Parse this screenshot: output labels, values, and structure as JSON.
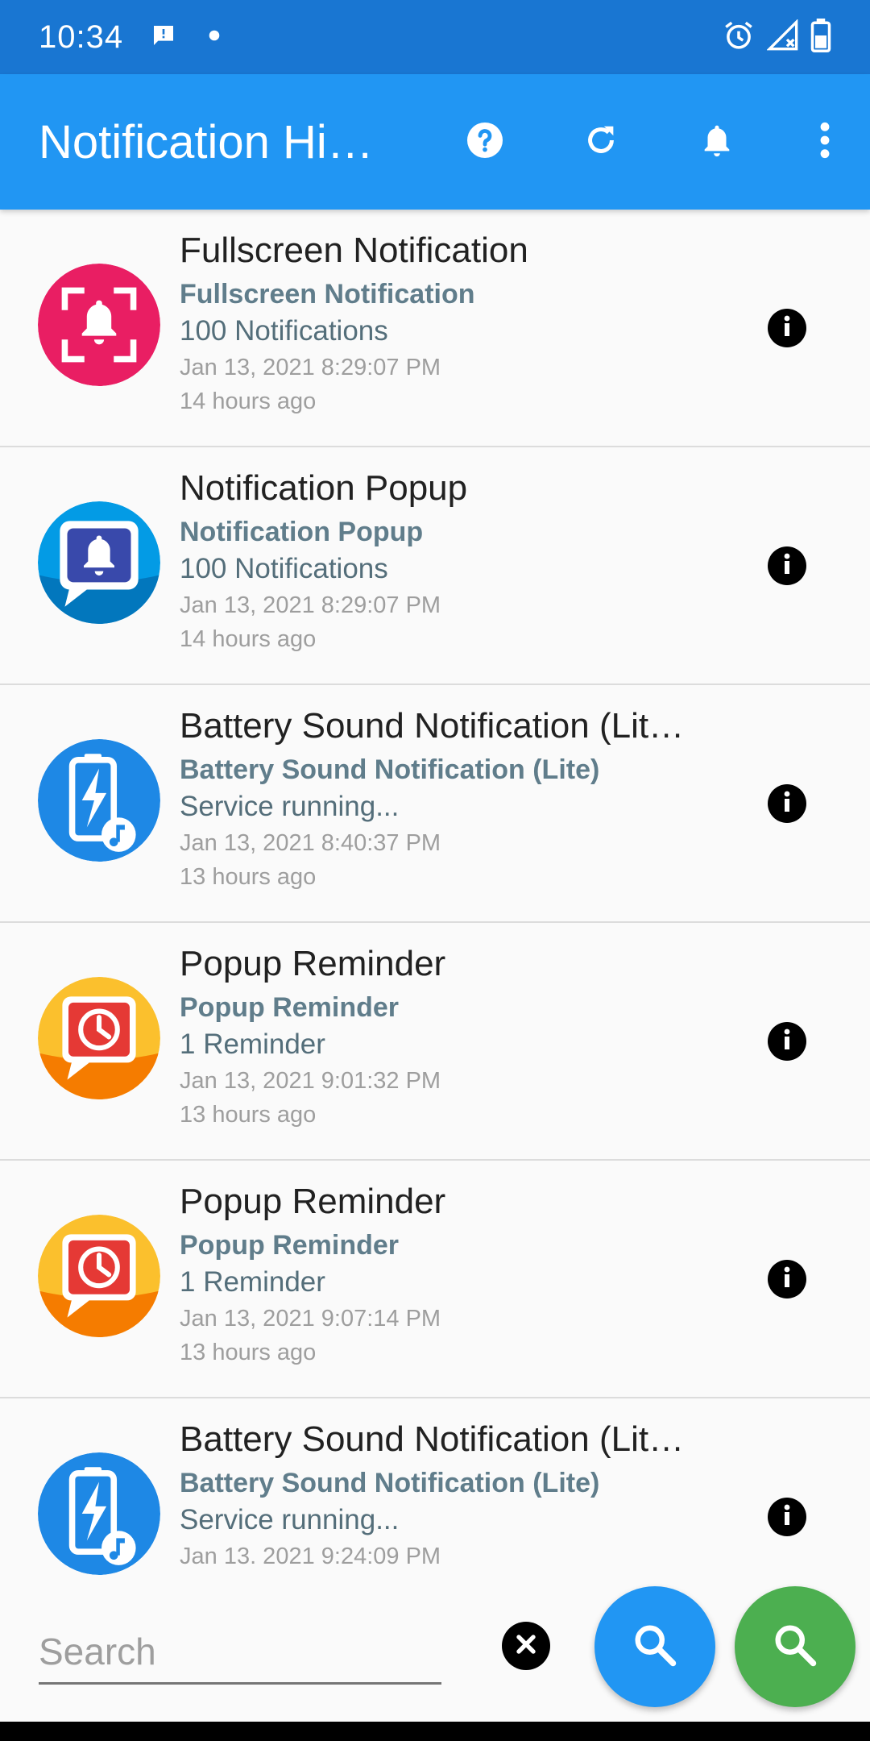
{
  "status_bar": {
    "time": "10:34",
    "icons": [
      "message-icon",
      "dot-icon",
      "alarm-icon",
      "signal-icon",
      "battery-icon"
    ]
  },
  "app_bar": {
    "title": "Notification Hi…",
    "actions": [
      "help-icon",
      "refresh-icon",
      "bell-icon",
      "more-vert-icon"
    ]
  },
  "colors": {
    "status_bar": "#1976d2",
    "app_bar": "#2196f3",
    "fab_blue": "#2196f3",
    "fab_green": "#4caf50"
  },
  "notifications": [
    {
      "icon": "fullscreen-notification-app-icon",
      "title": "Fullscreen Notification",
      "subtitle": "Fullscreen Notification",
      "text": "100 Notifications",
      "date": "Jan 13, 2021 8:29:07 PM",
      "ago": "14 hours ago"
    },
    {
      "icon": "notification-popup-app-icon",
      "title": "Notification Popup",
      "subtitle": "Notification Popup",
      "text": "100 Notifications",
      "date": "Jan 13, 2021 8:29:07 PM",
      "ago": "14 hours ago"
    },
    {
      "icon": "battery-sound-app-icon",
      "title": "Battery Sound Notification (Lit…",
      "subtitle": "Battery Sound Notification (Lite)",
      "text": "Service running...",
      "date": "Jan 13, 2021 8:40:37 PM",
      "ago": "13 hours ago"
    },
    {
      "icon": "popup-reminder-app-icon",
      "title": "Popup Reminder",
      "subtitle": "Popup Reminder",
      "text": "1 Reminder",
      "date": "Jan 13, 2021 9:01:32 PM",
      "ago": "13 hours ago"
    },
    {
      "icon": "popup-reminder-app-icon",
      "title": "Popup Reminder",
      "subtitle": "Popup Reminder",
      "text": "1 Reminder",
      "date": "Jan 13, 2021 9:07:14 PM",
      "ago": "13 hours ago"
    },
    {
      "icon": "battery-sound-app-icon",
      "title": "Battery Sound Notification (Lit…",
      "subtitle": "Battery Sound Notification (Lite)",
      "text": "Service running...",
      "date": "Jan 13. 2021 9:24:09 PM",
      "ago": ""
    }
  ],
  "search": {
    "placeholder": "Search",
    "value": ""
  }
}
